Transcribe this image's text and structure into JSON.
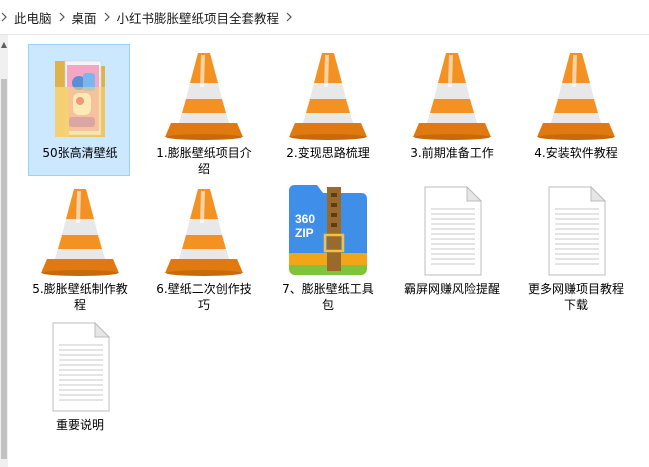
{
  "breadcrumb": {
    "items": [
      "此电脑",
      "桌面",
      "小红书膨胀壁纸项目全套教程"
    ]
  },
  "files": [
    {
      "name": "50张高清壁纸",
      "icon": "folder-with-preview-icon",
      "selected": true
    },
    {
      "name": "1.膨胀壁纸项目介绍",
      "icon": "vlc-media-file-icon"
    },
    {
      "name": "2.变现思路梳理",
      "icon": "vlc-media-file-icon"
    },
    {
      "name": "3.前期准备工作",
      "icon": "vlc-media-file-icon"
    },
    {
      "name": "4.安装软件教程",
      "icon": "vlc-media-file-icon"
    },
    {
      "name": "5.膨胀壁纸制作教程",
      "icon": "vlc-media-file-icon"
    },
    {
      "name": "6.壁纸二次创作技巧",
      "icon": "vlc-media-file-icon"
    },
    {
      "name": "7、膨胀壁纸工具包",
      "icon": "360zip-archive-icon",
      "icon_text": "360 ZIP"
    },
    {
      "name": "霸屏网赚风险提醒",
      "icon": "text-document-icon"
    },
    {
      "name": "更多网赚项目教程下载",
      "icon": "text-document-icon"
    },
    {
      "name": "重要说明",
      "icon": "text-document-icon"
    }
  ],
  "colors": {
    "selection_bg": "#cce8ff",
    "selection_border": "#99d1ff",
    "cone_orange": "#f08a12",
    "zip_blue": "#3f8fe8",
    "zip_green": "#7cc43a"
  }
}
